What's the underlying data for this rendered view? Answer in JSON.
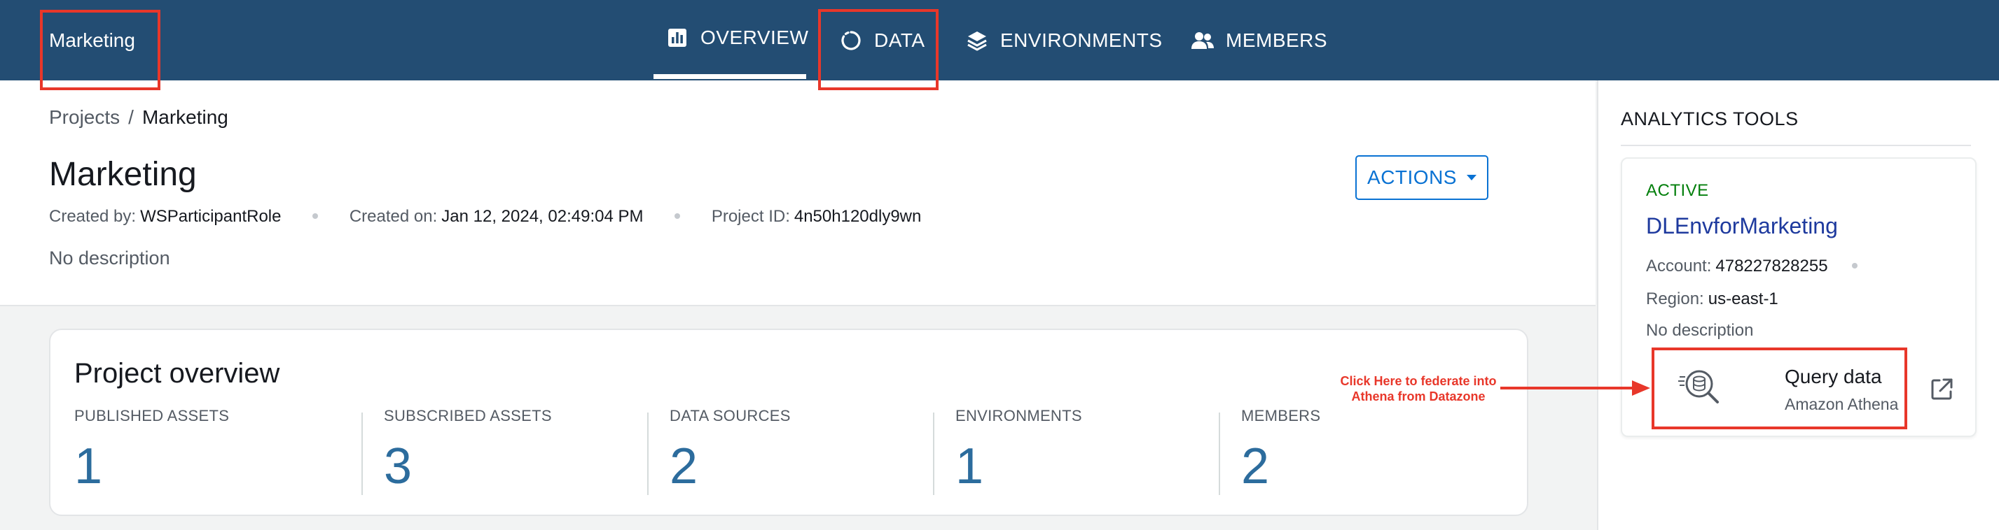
{
  "header": {
    "project_name": "Marketing",
    "tabs": [
      {
        "label": "OVERVIEW",
        "icon": "bar-chart-icon",
        "active": true
      },
      {
        "label": "DATA",
        "icon": "circle-loader-icon",
        "active": false
      },
      {
        "label": "ENVIRONMENTS",
        "icon": "layers-icon",
        "active": false
      },
      {
        "label": "MEMBERS",
        "icon": "people-icon",
        "active": false
      }
    ]
  },
  "breadcrumb": {
    "parent": "Projects",
    "separator": "/",
    "current": "Marketing"
  },
  "project": {
    "title": "Marketing",
    "created_by_label": "Created by:",
    "created_by": "WSParticipantRole",
    "created_on_label": "Created on:",
    "created_on": "Jan 12, 2024, 02:49:04 PM",
    "project_id_label": "Project ID:",
    "project_id": "4n50h120dly9wn",
    "description": "No description",
    "actions_label": "ACTIONS"
  },
  "overview": {
    "title": "Project overview",
    "stats": [
      {
        "label": "PUBLISHED ASSETS",
        "value": "1"
      },
      {
        "label": "SUBSCRIBED ASSETS",
        "value": "3"
      },
      {
        "label": "DATA SOURCES",
        "value": "2"
      },
      {
        "label": "ENVIRONMENTS",
        "value": "1"
      },
      {
        "label": "MEMBERS",
        "value": "2"
      }
    ]
  },
  "analytics": {
    "title": "ANALYTICS TOOLS",
    "environment": {
      "status": "ACTIVE",
      "name": "DLEnvforMarketing",
      "account_label": "Account:",
      "account": "478227828255",
      "region_label": "Region:",
      "region": "us-east-1",
      "description": "No description"
    },
    "tool": {
      "title": "Query data",
      "subtitle": "Amazon Athena",
      "icon": "athena-query-icon"
    }
  },
  "annotation": {
    "text_line1": "Click Here to federate into",
    "text_line2": "Athena from Datazone",
    "color": "#e8372a"
  },
  "colors": {
    "header_bg": "#234d73",
    "link_blue": "#0972d3",
    "stat_value": "#2c6c9d",
    "active_green": "#037f0c",
    "env_name": "#1e3a9e"
  }
}
